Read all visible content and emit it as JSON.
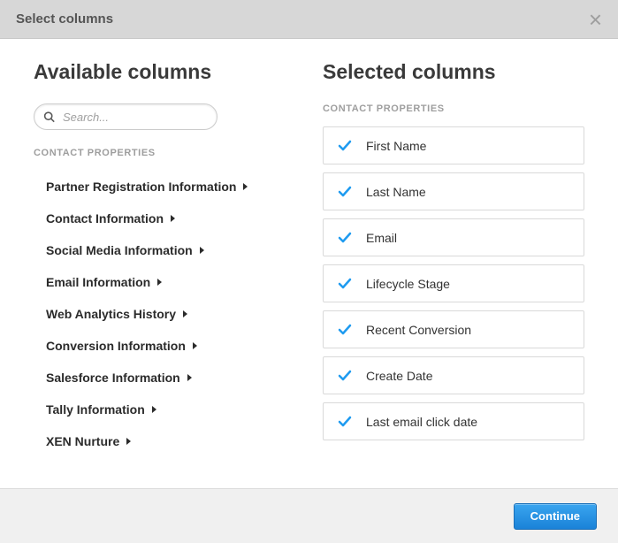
{
  "header": {
    "title": "Select columns"
  },
  "available": {
    "title": "Available columns",
    "search_placeholder": "Search...",
    "group_label": "CONTACT PROPERTIES",
    "categories": [
      {
        "label": "Partner Registration Information"
      },
      {
        "label": "Contact Information"
      },
      {
        "label": "Social Media Information"
      },
      {
        "label": "Email Information"
      },
      {
        "label": "Web Analytics History"
      },
      {
        "label": "Conversion Information"
      },
      {
        "label": "Salesforce Information"
      },
      {
        "label": "Tally Information"
      },
      {
        "label": "XEN Nurture"
      }
    ]
  },
  "selected": {
    "title": "Selected columns",
    "group_label": "CONTACT PROPERTIES",
    "items": [
      {
        "label": "First Name"
      },
      {
        "label": "Last Name"
      },
      {
        "label": "Email"
      },
      {
        "label": "Lifecycle Stage"
      },
      {
        "label": "Recent Conversion"
      },
      {
        "label": "Create Date"
      },
      {
        "label": "Last email click date"
      }
    ]
  },
  "footer": {
    "continue_label": "Continue"
  }
}
